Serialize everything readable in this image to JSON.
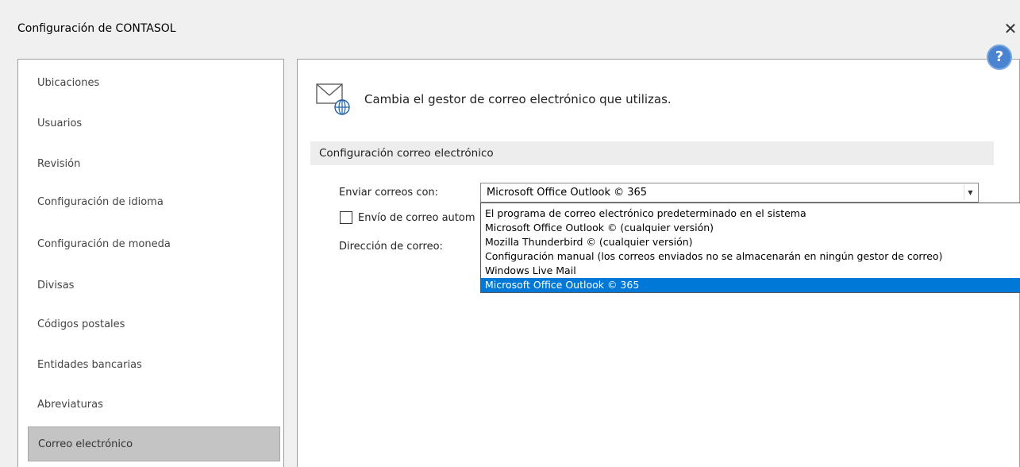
{
  "window": {
    "title": "Configuración de CONTASOL",
    "close_glyph": "✕",
    "help_glyph": "?"
  },
  "sidebar": {
    "items": [
      {
        "label": "Ubicaciones"
      },
      {
        "label": "Usuarios"
      },
      {
        "label": "Revisión"
      },
      {
        "label": "Configuración de idioma"
      },
      {
        "label": "Configuración de moneda"
      },
      {
        "label": "Divisas"
      },
      {
        "label": "Códigos postales"
      },
      {
        "label": "Entidades bancarias"
      },
      {
        "label": "Abreviaturas"
      },
      {
        "label": "Correo electrónico",
        "active": true
      }
    ]
  },
  "main": {
    "header_icon": "mail-globe-icon",
    "header_text": "Cambia el gestor de correo electrónico que utilizas.",
    "section_title": "Configuración correo electrónico",
    "send_with_label": "Enviar correos con:",
    "send_with_value": "Microsoft Office Outlook © 365",
    "auto_send_label": "Envío de correo autom",
    "auto_send_checked": false,
    "address_label": "Dirección de correo:",
    "dropdown_options": [
      "El programa de correo electrónico predeterminado en el sistema",
      "Microsoft Office Outlook © (cualquier versión)",
      "Mozilla Thunderbird © (cualquier versión)",
      "Configuración manual (los correos enviados no se almacenarán en ningún gestor de correo)",
      "Windows Live Mail",
      "Microsoft Office Outlook © 365"
    ],
    "selected_option_index": 5
  },
  "colors": {
    "accent": "#0078d7",
    "help_button": "#4a83cf",
    "active_item_bg": "#c4c4c4"
  }
}
